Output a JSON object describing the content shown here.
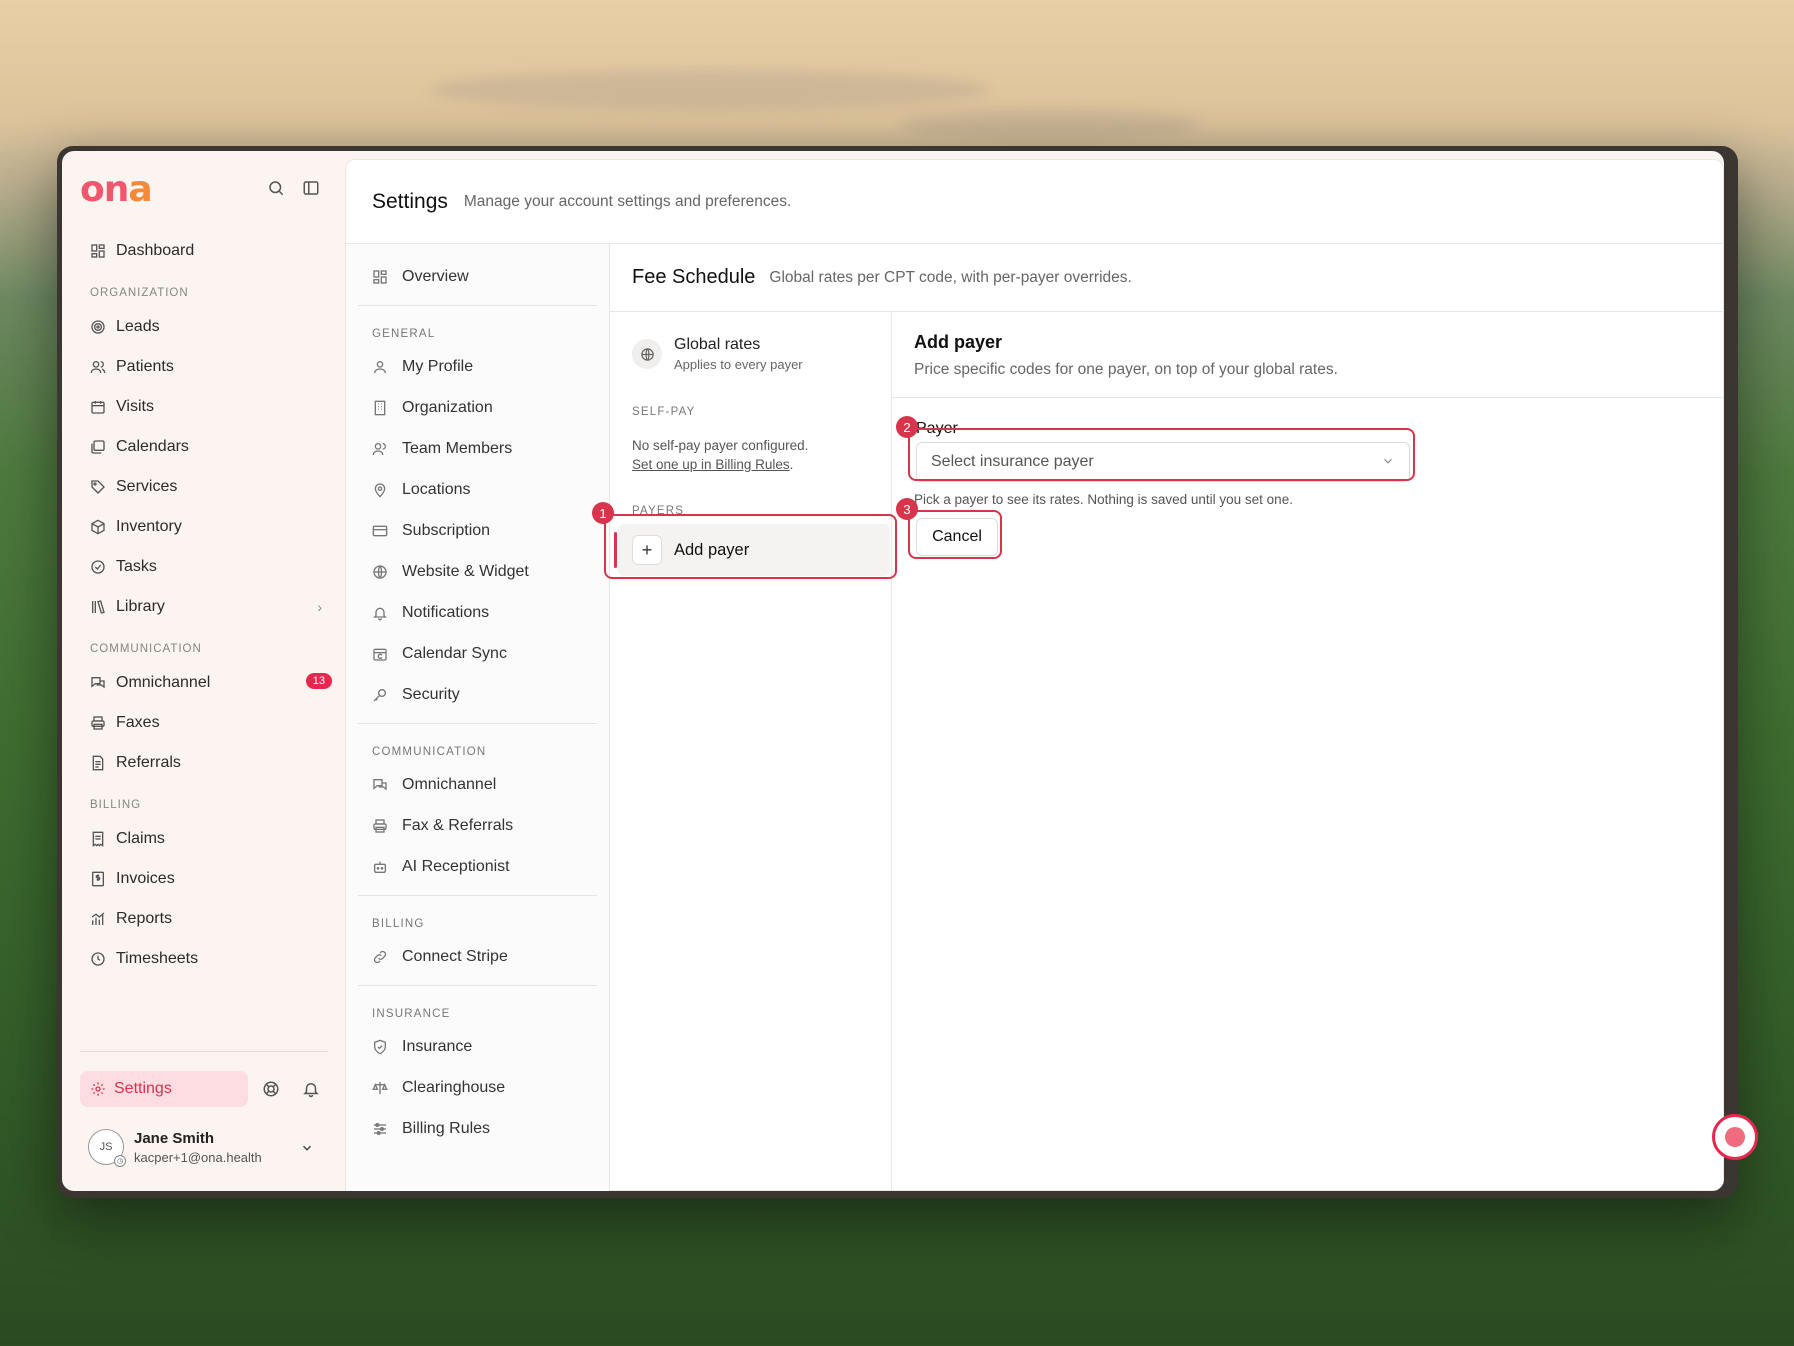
{
  "brand": {
    "logo_main": "on",
    "logo_accent": "a"
  },
  "sidebar": {
    "items_top": [
      {
        "label": "Dashboard",
        "icon": "dashboard-icon"
      }
    ],
    "sections": [
      {
        "title": "ORGANIZATION",
        "items": [
          {
            "label": "Leads",
            "icon": "target-icon"
          },
          {
            "label": "Patients",
            "icon": "users-icon"
          },
          {
            "label": "Visits",
            "icon": "calendar-icon"
          },
          {
            "label": "Calendars",
            "icon": "calendars-icon"
          },
          {
            "label": "Services",
            "icon": "tag-icon"
          },
          {
            "label": "Inventory",
            "icon": "box-icon"
          },
          {
            "label": "Tasks",
            "icon": "check-circle-icon"
          },
          {
            "label": "Library",
            "icon": "library-icon",
            "has_chevron": true
          }
        ]
      },
      {
        "title": "COMMUNICATION",
        "items": [
          {
            "label": "Omnichannel",
            "icon": "chat-icon",
            "badge": "13"
          },
          {
            "label": "Faxes",
            "icon": "printer-icon"
          },
          {
            "label": "Referrals",
            "icon": "document-icon"
          }
        ]
      },
      {
        "title": "BILLING",
        "items": [
          {
            "label": "Claims",
            "icon": "receipt-icon"
          },
          {
            "label": "Invoices",
            "icon": "invoice-icon"
          },
          {
            "label": "Reports",
            "icon": "chart-icon"
          },
          {
            "label": "Timesheets",
            "icon": "clock-icon"
          }
        ]
      }
    ],
    "settings_label": "Settings",
    "user": {
      "initials": "JS",
      "name": "Jane Smith",
      "email": "kacper+1@ona.health"
    }
  },
  "header": {
    "title": "Settings",
    "subtitle": "Manage your account settings and preferences."
  },
  "settings_nav": {
    "overview": "Overview",
    "sections": [
      {
        "title": "GENERAL",
        "items": [
          {
            "label": "My Profile",
            "icon": "user-icon"
          },
          {
            "label": "Organization",
            "icon": "building-icon"
          },
          {
            "label": "Team Members",
            "icon": "team-icon"
          },
          {
            "label": "Locations",
            "icon": "pin-icon"
          },
          {
            "label": "Subscription",
            "icon": "card-icon"
          },
          {
            "label": "Website & Widget",
            "icon": "globe-icon"
          },
          {
            "label": "Notifications",
            "icon": "bell-icon"
          },
          {
            "label": "Calendar Sync",
            "icon": "calendar-sync-icon"
          },
          {
            "label": "Security",
            "icon": "key-icon"
          }
        ]
      },
      {
        "title": "COMMUNICATION",
        "items": [
          {
            "label": "Omnichannel",
            "icon": "chat-icon"
          },
          {
            "label": "Fax & Referrals",
            "icon": "printer-icon"
          },
          {
            "label": "AI Receptionist",
            "icon": "bot-icon"
          }
        ]
      },
      {
        "title": "BILLING",
        "items": [
          {
            "label": "Connect Stripe",
            "icon": "link-icon"
          }
        ]
      },
      {
        "title": "INSURANCE",
        "items": [
          {
            "label": "Insurance",
            "icon": "shield-icon"
          },
          {
            "label": "Clearinghouse",
            "icon": "scale-icon"
          },
          {
            "label": "Billing Rules",
            "icon": "sliders-icon"
          }
        ]
      }
    ]
  },
  "fee_schedule": {
    "title": "Fee Schedule",
    "subtitle": "Global rates per CPT code, with per-payer overrides.",
    "global_rates": {
      "title": "Global rates",
      "subtitle": "Applies to every payer"
    },
    "self_pay": {
      "title": "SELF-PAY",
      "text": "No self-pay payer configured.",
      "link": "Set one up in Billing Rules",
      "link_suffix": "."
    },
    "payers_title": "PAYERS",
    "add_payer": "Add payer"
  },
  "add_payer_panel": {
    "title": "Add payer",
    "subtitle": "Price specific codes for one payer, on top of your global rates.",
    "payer_label": "Payer",
    "select_placeholder": "Select insurance payer",
    "hint": "Pick a payer to see its rates. Nothing is saved until you set one.",
    "cancel": "Cancel"
  },
  "annotations": [
    "1",
    "2",
    "3"
  ],
  "colors": {
    "accent": "#d8344c",
    "badge": "#e8274f",
    "logo_pink": "#f2566c",
    "logo_orange": "#f28a3a"
  }
}
